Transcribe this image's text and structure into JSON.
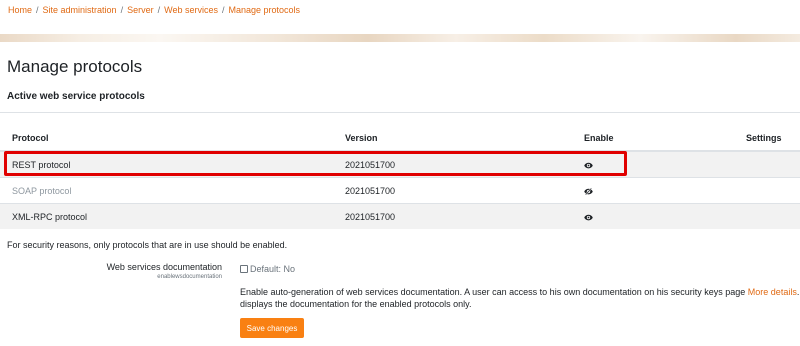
{
  "breadcrumb": {
    "items": [
      "Home",
      "Site administration",
      "Server",
      "Web services",
      "Manage protocols"
    ],
    "separator": "/"
  },
  "page_title": "Manage protocols",
  "section_title": "Active web service protocols",
  "table": {
    "headers": [
      "Protocol",
      "Version",
      "Enable",
      "Settings"
    ],
    "rows": [
      {
        "protocol": "REST protocol",
        "version": "2021051700",
        "enabled": true,
        "enable_icon": "eye-icon"
      },
      {
        "protocol": "SOAP protocol",
        "version": "2021051700",
        "enabled": false,
        "enable_icon": "eye-slash-icon"
      },
      {
        "protocol": "XML-RPC protocol",
        "version": "2021051700",
        "enabled": true,
        "enable_icon": "eye-icon"
      }
    ]
  },
  "security_note": "For security reasons, only protocols that are in use should be enabled.",
  "setting": {
    "label": "Web services documentation",
    "key": "enablewsdocumentation",
    "checkbox_label": "Default: No",
    "checked": false,
    "desc_before": "Enable auto-generation of web services documentation. A user can access to his own documentation on his security keys page ",
    "desc_link": "More details",
    "desc_after": ". It displays the documentation for the enabled protocols only."
  },
  "save_button": "Save changes",
  "colors": {
    "accent": "#f98012",
    "link": "#e06a14",
    "highlight": "#e00000",
    "row_stripe": "#f2f2f2"
  }
}
